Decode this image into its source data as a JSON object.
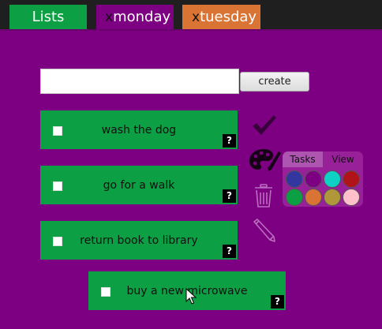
{
  "tabs": [
    {
      "label": "Lists",
      "close": "",
      "color": "#0d9f43"
    },
    {
      "label": "monday",
      "close": "x",
      "color": "#7d0082"
    },
    {
      "label": "tuesday",
      "close": "x",
      "color": "#d97434"
    }
  ],
  "new_task": {
    "value": "",
    "placeholder": "",
    "create_label": "create"
  },
  "tasks": [
    {
      "label": "wash the dog",
      "checked": false,
      "help": "?"
    },
    {
      "label": "go for a walk",
      "checked": false,
      "help": "?"
    },
    {
      "label": "return book to library",
      "checked": false,
      "help": "?"
    },
    {
      "label": "buy a new microwave",
      "checked": false,
      "help": "?"
    }
  ],
  "side_icons": [
    "check-icon",
    "palette-icon",
    "trash-icon",
    "pencil-icon"
  ],
  "palette": {
    "tabs": [
      "Tasks",
      "View"
    ],
    "swatches": [
      "#3436a0",
      "#7d0082",
      "#0fd0c5",
      "#b0141a",
      "#0d9f43",
      "#d97434",
      "#b0983a",
      "#ffc0cb"
    ]
  },
  "colors": {
    "background": "#7d0082",
    "task": "#0d9f43",
    "tab_bar": "#1f1f1f"
  }
}
